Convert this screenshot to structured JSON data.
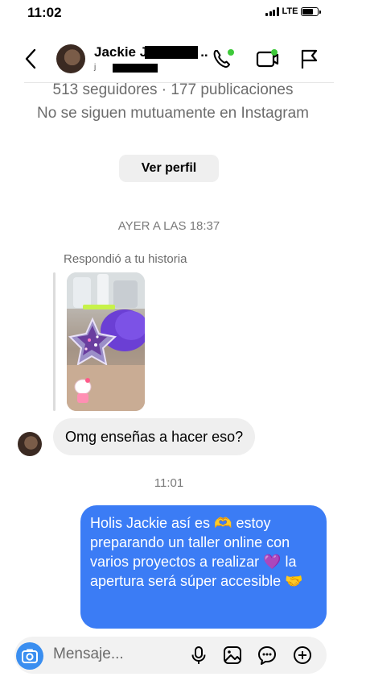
{
  "status_bar": {
    "time": "11:02",
    "network": "LTE",
    "signal_bars": 4,
    "battery_level": 0.7
  },
  "header": {
    "contact_name": "Jackie J",
    "contact_name_suffix": "..",
    "username_hint": "j",
    "icons": [
      "back-icon",
      "phone-icon",
      "video-camera-icon",
      "flag-icon"
    ],
    "active_status_color": "#3ec93a"
  },
  "profile": {
    "stats": "513 seguidores · 177 publicaciones",
    "mutual_status": "No se siguen mutuamente en Instagram",
    "view_profile_label": "Ver perfil"
  },
  "conversation": {
    "date_divider": "AYER A LAS 18:37",
    "story_reply_label": "Respondió a tu historia",
    "incoming_message": "Omg enseñas a hacer eso?",
    "time_divider": "11:01",
    "outgoing_message": "Holis Jackie así es 🫶 estoy preparando un taller online con varios proyectos a realizar 💜 la apertura será súper accesible 🤝"
  },
  "composer": {
    "placeholder": "Mensaje...",
    "icons": [
      "camera-icon",
      "microphone-icon",
      "gallery-icon",
      "sticker-icon",
      "add-icon"
    ]
  },
  "colors": {
    "outgoing_bubble": "#3b7cf5",
    "incoming_bubble": "#efefef",
    "camera_button": "#3a8ef0"
  }
}
